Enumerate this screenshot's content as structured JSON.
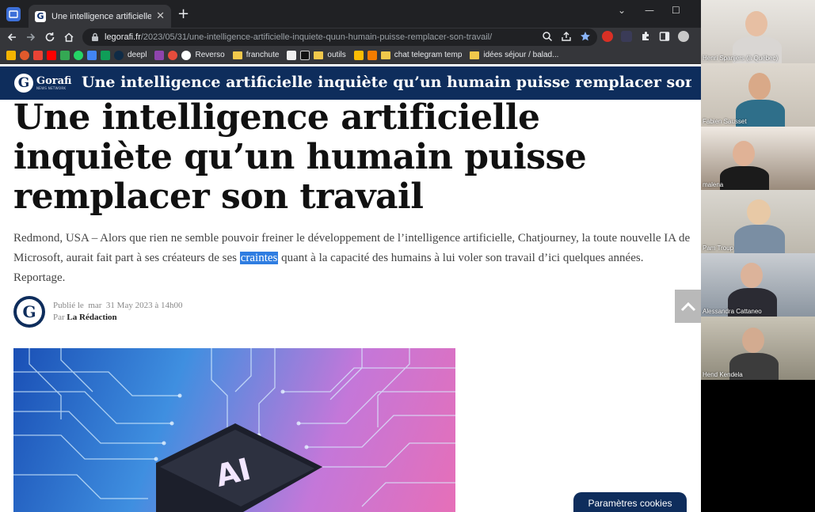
{
  "browser": {
    "tab": {
      "title": "Une intelligence artificielle inquiè",
      "favicon": "G"
    },
    "url": {
      "domain": "legorafi.fr",
      "path": "/2023/05/31/une-intelligence-artificielle-inquiete-quun-humain-puisse-remplacer-son-travail/"
    },
    "bookmarks": [
      "deepl",
      "Reverso",
      "franchute",
      "outils",
      "chat telegram temp",
      "idées séjour / balad..."
    ]
  },
  "site": {
    "logo_text": "Gorafi",
    "logo_sub": "NEWS NETWORK",
    "logo_letter": "G",
    "header_title": "Une intelligence artificielle inquiète qu’un humain puisse remplacer son t"
  },
  "article": {
    "title": "Une intelligence artificielle inquiète qu’un humain puisse remplacer son travail",
    "lede_before": "Redmond, USA – Alors que rien ne semble pouvoir freiner le développement de l’intelligence artificielle, Chatjourney, la toute nouvelle IA de Microsoft, aurait fait part à ses créateurs de ses ",
    "lede_highlight": "craintes",
    "lede_after": " quant à la capacité des humains à lui voler son travail d’ici quelques années. Reportage.",
    "published_label": "Publié le",
    "published_day": "mar",
    "published_date": "31 May 2023 à 14h00",
    "by_label": "Par",
    "author": "La Rédaction",
    "hero_text": "AI"
  },
  "ui": {
    "cookie_button": "Paramètres cookies"
  },
  "call": {
    "participants": [
      {
        "name": "Henri Spanjers (à Québec)"
      },
      {
        "name": "Fabien Sausset"
      },
      {
        "name": "malena"
      },
      {
        "name": "Pam Troup"
      },
      {
        "name": "Alessandra Cattaneo"
      },
      {
        "name": "Hend Kendela"
      }
    ]
  },
  "colors": {
    "brand": "#0e2d5c",
    "highlight": "#2f7de1"
  }
}
